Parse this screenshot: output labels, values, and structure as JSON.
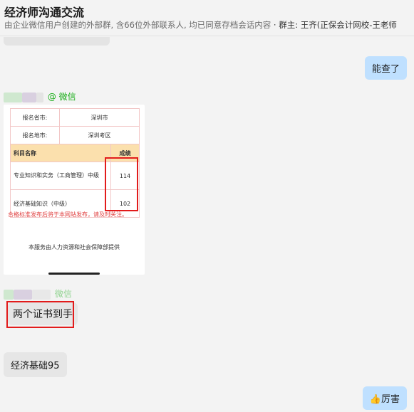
{
  "header": {
    "title": "经济师沟通交流",
    "subtitle": "由企业微信用户创建的外部群, 含66位外部联系人, 均已同意存档会话内容",
    "owner": "· 群主: 王齐(正保会计网校-王老师"
  },
  "messages": [
    {
      "from": "me",
      "text": "能查了"
    },
    {
      "from": "member",
      "source": "@ 微信",
      "type": "image"
    },
    {
      "from": "member",
      "source": "微信",
      "text": "两个证书到手"
    },
    {
      "from": "member",
      "text": "经济基础95"
    },
    {
      "from": "me",
      "emoji": "👍",
      "text": "厉害"
    }
  ],
  "score_card": {
    "rows": [
      {
        "label": "报名省市:",
        "value": "深圳市"
      },
      {
        "label": "报名地市:",
        "value": "深圳考区"
      }
    ],
    "score_header": {
      "subject": "科目名称",
      "score": "成绩"
    },
    "scores": [
      {
        "subject": "专业知识和实务（工商管理）中级",
        "score": "114"
      },
      {
        "subject": "经济基础知识（中级）",
        "score": "102"
      }
    ],
    "note": "合格标准发布后将于本网站发布，请及时关注。",
    "service": "本服务由人力资源和社会保障部提供"
  },
  "colors": {
    "my_bubble": "#bfe0ff",
    "their_bubble": "#e6e6e6",
    "wechat_green": "#1aad19",
    "highlight_red": "#e21b1b"
  }
}
